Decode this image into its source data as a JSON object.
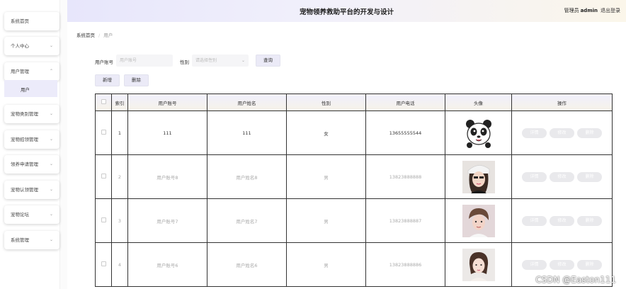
{
  "header": {
    "title": "宠物领养救助平台的开发与设计",
    "role": "管理员",
    "username": "admin",
    "logout": "退出登录"
  },
  "sidebar": {
    "items": [
      {
        "label": "系统首页",
        "has_chevron": false
      },
      {
        "label": "个人中心",
        "has_chevron": true
      },
      {
        "label": "用户管理",
        "has_chevron": true,
        "expanded": true
      },
      {
        "label": "宠物类别管理",
        "has_chevron": true
      },
      {
        "label": "宠物招领管理",
        "has_chevron": true
      },
      {
        "label": "领养申请管理",
        "has_chevron": true
      },
      {
        "label": "宠物认领管理",
        "has_chevron": true
      },
      {
        "label": "宠物论坛",
        "has_chevron": true
      },
      {
        "label": "系统管理",
        "has_chevron": true
      }
    ],
    "submenu_label": "用户"
  },
  "breadcrumb": {
    "home": "系统首页",
    "sep": "/",
    "current": "用户"
  },
  "search": {
    "account_label": "用户账号",
    "account_placeholder": "用户账号",
    "gender_label": "性别",
    "gender_placeholder": "请选择性别",
    "query_button": "查询"
  },
  "toolbar": {
    "add_button": "新增",
    "delete_button": "删除"
  },
  "table": {
    "headers": [
      "索引",
      "用户账号",
      "用户姓名",
      "性别",
      "用户电话",
      "头像",
      "操作"
    ],
    "rows": [
      {
        "index": "1",
        "account": "111",
        "name": "111",
        "gender": "女",
        "phone": "13655555544",
        "avatar": "panda-avatar"
      },
      {
        "index": "2",
        "account": "用户账号8",
        "name": "用户姓名8",
        "gender": "男",
        "phone": "13823888888",
        "avatar": "photo-avatar-woman-cap"
      },
      {
        "index": "3",
        "account": "用户账号7",
        "name": "用户姓名7",
        "gender": "男",
        "phone": "13823888887",
        "avatar": "photo-avatar-man"
      },
      {
        "index": "4",
        "account": "用户账号6",
        "name": "用户姓名6",
        "gender": "男",
        "phone": "13823888886",
        "avatar": "photo-avatar-woman"
      }
    ],
    "actions": [
      "详情",
      "修改",
      "删除"
    ]
  },
  "watermark": "CSDN @Easton111"
}
